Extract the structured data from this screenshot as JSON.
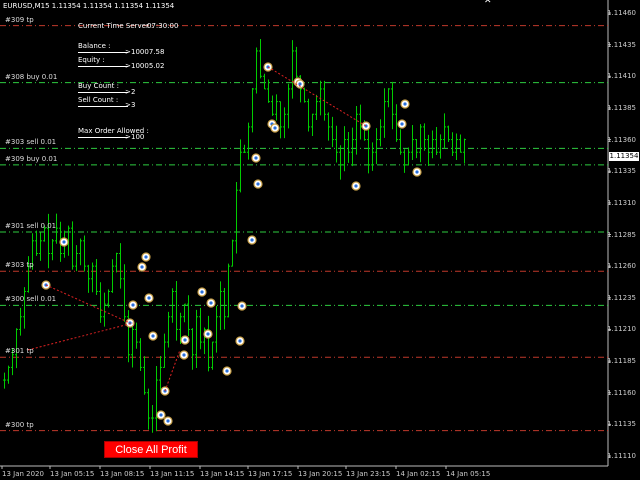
{
  "header": {
    "title": "EURUSD,M15  1.11354 1.11354 1.11354 1.11354"
  },
  "info_panel": {
    "server_time_label": "Current Time Server :",
    "server_time_value": "07:30:00",
    "balance_label": "Balance :",
    "balance_value": "10007.58",
    "equity_label": "Equity :",
    "equity_value": "10005.02",
    "buy_count_label": "Buy Count :",
    "buy_count_value": "2",
    "sell_count_label": "Sell Count :",
    "sell_count_value": "3",
    "max_order_label": "Max Order Allowed :",
    "max_order_value": "100",
    "arrow": ">"
  },
  "order_lines": [
    {
      "label": "#309 tp",
      "price": 1.1145,
      "color": "#c0392b"
    },
    {
      "label": "#308 buy 0.01",
      "price": 1.11405,
      "color": "#2ecc40"
    },
    {
      "label": "#303 sell 0.01",
      "price": 1.11353,
      "color": "#2ecc40"
    },
    {
      "label": "#309 buy 0.01",
      "price": 1.1134,
      "color": "#2ecc40"
    },
    {
      "label": "#301 sell 0.01",
      "price": 1.11287,
      "color": "#2ecc40"
    },
    {
      "label": "#303 tp",
      "price": 1.11256,
      "color": "#c0392b"
    },
    {
      "label": "#300 sell 0.01",
      "price": 1.11229,
      "color": "#2ecc40"
    },
    {
      "label": "#301 tp",
      "price": 1.11188,
      "color": "#c0392b"
    },
    {
      "label": "#300 tp",
      "price": 1.1113,
      "color": "#c0392b"
    }
  ],
  "price_axis": {
    "labels": [
      "1.11460",
      "1.11435",
      "1.11410",
      "1.11385",
      "1.11360",
      "1.11335",
      "1.11310",
      "1.11285",
      "1.11260",
      "1.11235",
      "1.11210",
      "1.11185",
      "1.11160",
      "1.11135",
      "1.11110"
    ],
    "current_price": "1.11354"
  },
  "time_axis": {
    "labels": [
      "13 Jan 2020",
      "13 Jan 05:15",
      "13 Jan 08:15",
      "13 Jan 11:15",
      "13 Jan 14:15",
      "13 Jan 17:15",
      "13 Jan 20:15",
      "13 Jan 23:15",
      "14 Jan 02:15",
      "14 Jan 05:15"
    ]
  },
  "buttons": {
    "close_all_profit": "Close All Profit"
  },
  "colors": {
    "bars": "#00cc00",
    "background": "#000000",
    "tp_line": "#c0392b",
    "order_line": "#2ecc40"
  },
  "chart_data": {
    "type": "bar",
    "symbol": "EURUSD",
    "timeframe": "M15",
    "ylim": [
      1.11105,
      1.11465
    ],
    "closes": [
      1.1117,
      1.1118,
      1.1119,
      1.1121,
      1.1122,
      1.1124,
      1.1126,
      1.1128,
      1.1127,
      1.1128,
      1.1129,
      1.1127,
      1.1128,
      1.1129,
      1.1127,
      1.1128,
      1.1129,
      1.1126,
      1.1127,
      1.1128,
      1.1126,
      1.1125,
      1.1126,
      1.1124,
      1.1122,
      1.1123,
      1.1124,
      1.1126,
      1.1127,
      1.1125,
      1.1122,
      1.1119,
      1.1121,
      1.112,
      1.1118,
      1.1116,
      1.1114,
      1.1114,
      1.1117,
      1.1118,
      1.112,
      1.1122,
      1.1124,
      1.1121,
      1.1122,
      1.1123,
      1.1121,
      1.1119,
      1.1122,
      1.112,
      1.1121,
      1.1118,
      1.112,
      1.1122,
      1.1124,
      1.1122,
      1.1126,
      1.1128,
      1.1132,
      1.1135,
      1.1135,
      1.1137,
      1.114,
      1.1143,
      1.1141,
      1.114,
      1.1139,
      1.1138,
      1.1139,
      1.1137,
      1.1138,
      1.114,
      1.1143,
      1.1141,
      1.114,
      1.1139,
      1.1137,
      1.1138,
      1.1139,
      1.114,
      1.1138,
      1.1137,
      1.1136,
      1.1135,
      1.1134,
      1.1136,
      1.1135,
      1.1136,
      1.1138,
      1.1137,
      1.1136,
      1.1134,
      1.1135,
      1.1136,
      1.1137,
      1.1139,
      1.114,
      1.1138,
      1.1136,
      1.1135,
      1.1134,
      1.1135,
      1.1136,
      1.1135,
      1.1137,
      1.1136,
      1.1135,
      1.1136,
      1.1135,
      1.1136,
      1.1137,
      1.1136,
      1.1135,
      1.1136,
      1.1135,
      1.1136
    ]
  }
}
